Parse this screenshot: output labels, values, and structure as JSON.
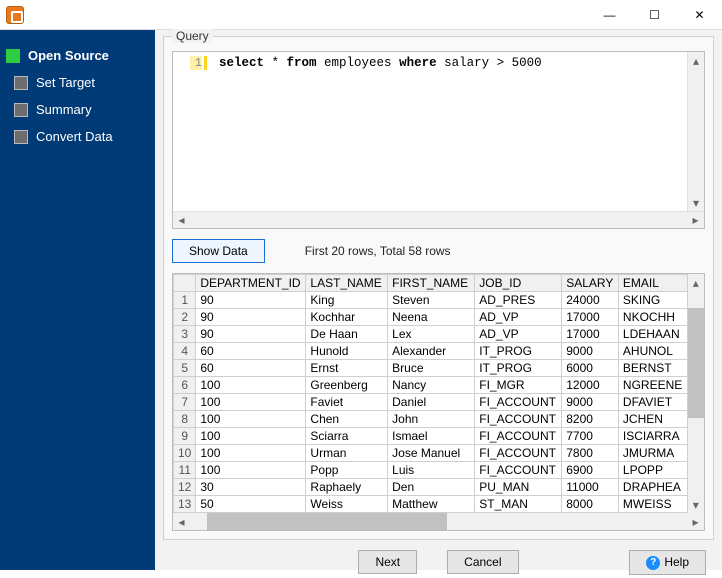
{
  "titlebar": {
    "minimize": "—",
    "maximize": "☐",
    "close": "✕"
  },
  "nav": {
    "items": [
      {
        "label": "Open Source",
        "active": true
      },
      {
        "label": "Set Target",
        "active": false
      },
      {
        "label": "Summary",
        "active": false
      },
      {
        "label": "Convert Data",
        "active": false
      }
    ]
  },
  "query_panel": {
    "label": "Query",
    "line_number": "1",
    "tokens": [
      "select",
      " * ",
      "from",
      " employees ",
      "where",
      " salary > 5000"
    ]
  },
  "controls": {
    "show_data": "Show Data",
    "status": "First 20 rows, Total 58 rows"
  },
  "table": {
    "headers": [
      "DEPARTMENT_ID",
      "LAST_NAME",
      "FIRST_NAME",
      "JOB_ID",
      "SALARY",
      "EMAIL"
    ],
    "rows": [
      [
        "90",
        "King",
        "Steven",
        "AD_PRES",
        "24000",
        "SKING"
      ],
      [
        "90",
        "Kochhar",
        "Neena",
        "AD_VP",
        "17000",
        "NKOCHH"
      ],
      [
        "90",
        "De Haan",
        "Lex",
        "AD_VP",
        "17000",
        "LDEHAAN"
      ],
      [
        "60",
        "Hunold",
        "Alexander",
        "IT_PROG",
        "9000",
        "AHUNOL"
      ],
      [
        "60",
        "Ernst",
        "Bruce",
        "IT_PROG",
        "6000",
        "BERNST"
      ],
      [
        "100",
        "Greenberg",
        "Nancy",
        "FI_MGR",
        "12000",
        "NGREENE"
      ],
      [
        "100",
        "Faviet",
        "Daniel",
        "FI_ACCOUNT",
        "9000",
        "DFAVIET"
      ],
      [
        "100",
        "Chen",
        "John",
        "FI_ACCOUNT",
        "8200",
        "JCHEN"
      ],
      [
        "100",
        "Sciarra",
        "Ismael",
        "FI_ACCOUNT",
        "7700",
        "ISCIARRA"
      ],
      [
        "100",
        "Urman",
        "Jose Manuel",
        "FI_ACCOUNT",
        "7800",
        "JMURMA"
      ],
      [
        "100",
        "Popp",
        "Luis",
        "FI_ACCOUNT",
        "6900",
        "LPOPP"
      ],
      [
        "30",
        "Raphaely",
        "Den",
        "PU_MAN",
        "11000",
        "DRAPHEA"
      ],
      [
        "50",
        "Weiss",
        "Matthew",
        "ST_MAN",
        "8000",
        "MWEISS"
      ]
    ]
  },
  "footer": {
    "next": "Next",
    "cancel": "Cancel",
    "help": "Help"
  }
}
